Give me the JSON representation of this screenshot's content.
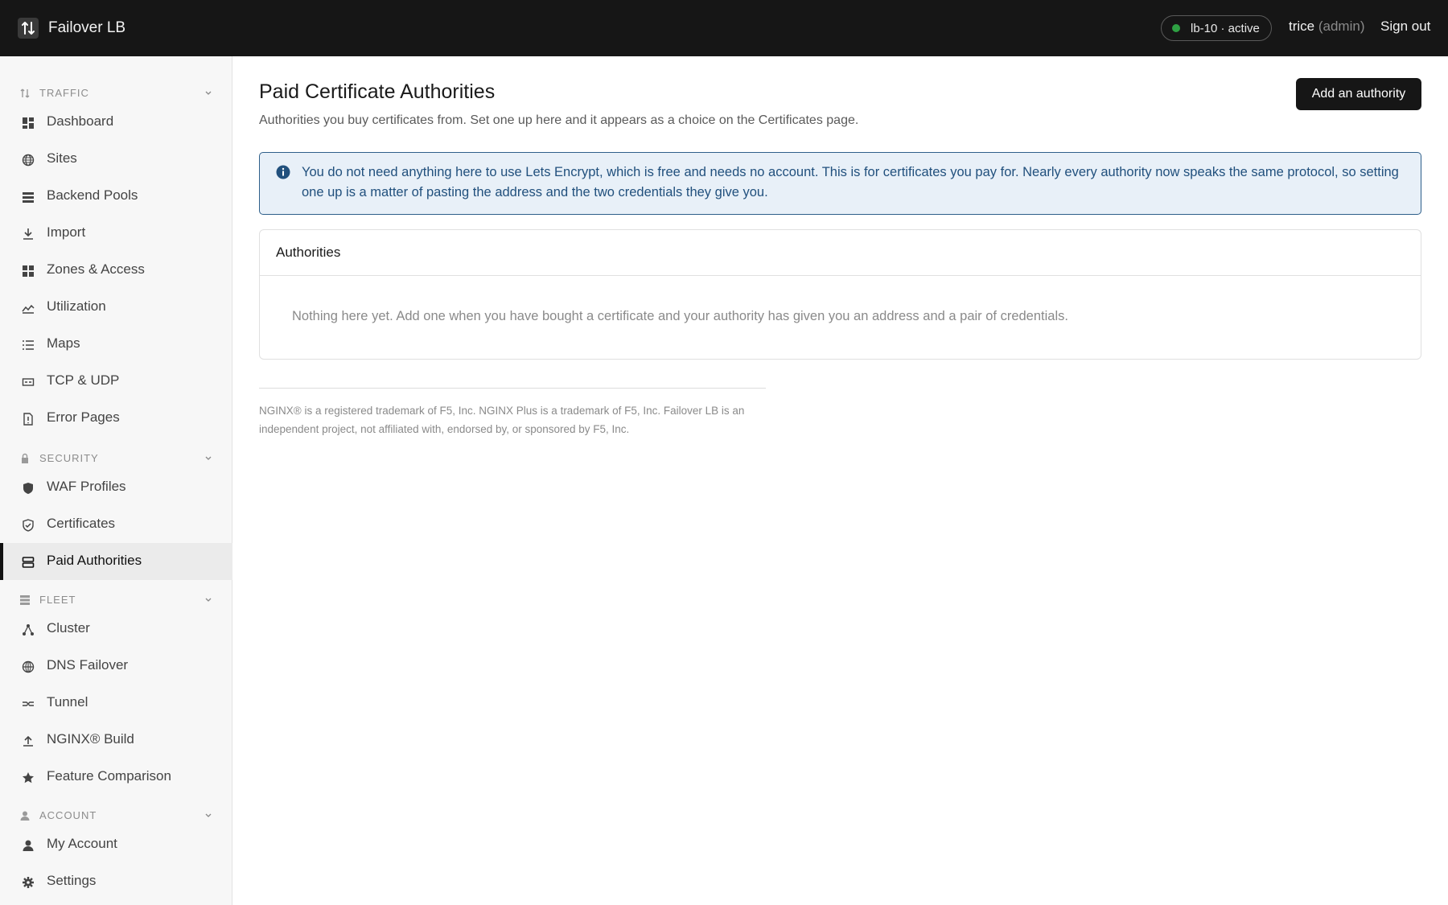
{
  "app": {
    "title": "Failover LB",
    "logo_icon": "arrows-up-down-icon"
  },
  "header": {
    "status_text": "lb-10 · active",
    "status_color": "#2ea043",
    "user_name": "trice",
    "user_role": "(admin)",
    "sign_out_label": "Sign out"
  },
  "sidebar": {
    "sections": [
      {
        "label": "TRAFFIC",
        "icon": "arrows-up-down-icon",
        "items": [
          {
            "label": "Dashboard",
            "icon": "dashboard-icon"
          },
          {
            "label": "Sites",
            "icon": "globe-icon"
          },
          {
            "label": "Backend Pools",
            "icon": "stack-icon"
          },
          {
            "label": "Import",
            "icon": "download-icon"
          },
          {
            "label": "Zones & Access",
            "icon": "grid-icon"
          },
          {
            "label": "Utilization",
            "icon": "chart-line-icon"
          },
          {
            "label": "Maps",
            "icon": "list-icon"
          },
          {
            "label": "TCP & UDP",
            "icon": "port-icon"
          },
          {
            "label": "Error Pages",
            "icon": "file-alert-icon"
          }
        ]
      },
      {
        "label": "SECURITY",
        "icon": "lock-icon",
        "items": [
          {
            "label": "WAF Profiles",
            "icon": "shield-filled-icon"
          },
          {
            "label": "Certificates",
            "icon": "shield-check-icon"
          },
          {
            "label": "Paid Authorities",
            "icon": "server-icon",
            "active": true
          }
        ]
      },
      {
        "label": "FLEET",
        "icon": "rack-icon",
        "items": [
          {
            "label": "Cluster",
            "icon": "cluster-icon"
          },
          {
            "label": "DNS Failover",
            "icon": "globe-network-icon"
          },
          {
            "label": "Tunnel",
            "icon": "tunnel-icon"
          },
          {
            "label": "NGINX® Build",
            "icon": "upload-icon"
          },
          {
            "label": "Feature Comparison",
            "icon": "star-icon"
          }
        ]
      },
      {
        "label": "ACCOUNT",
        "icon": "person-icon",
        "items": [
          {
            "label": "My Account",
            "icon": "person-icon"
          },
          {
            "label": "Settings",
            "icon": "gear-icon"
          }
        ]
      }
    ]
  },
  "main": {
    "title": "Paid Certificate Authorities",
    "subtitle": "Authorities you buy certificates from. Set one up here and it appears as a choice on the Certificates page.",
    "add_button_label": "Add an authority",
    "info_text": "You do not need anything here to use Lets Encrypt, which is free and needs no account. This is for certificates you pay for. Nearly every authority now speaks the same protocol, so setting one up is a matter of pasting the address and the two credentials they give you.",
    "card_title": "Authorities",
    "empty_text": "Nothing here yet. Add one when you have bought a certificate and your authority has given you an address and a pair of credentials.",
    "footer_text": "NGINX® is a registered trademark of F5, Inc. NGINX Plus is a trademark of F5, Inc. Failover LB is an independent project, not affiliated with, endorsed by, or sponsored by F5, Inc."
  },
  "colors": {
    "accent": "#161616",
    "info_bg": "#e8f0f8",
    "info_border": "#2e5f8a",
    "info_text": "#21507d"
  }
}
